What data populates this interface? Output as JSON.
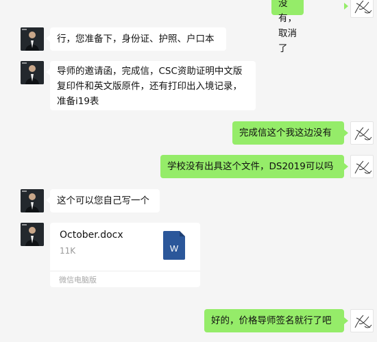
{
  "messages": [
    {
      "side": "right",
      "text": "没有，取消了"
    },
    {
      "side": "left",
      "text": "行，您准备下，身份证、护照、户口本"
    },
    {
      "side": "left",
      "lines": [
        "导师的邀请函，完成信，CSC资助证明中文版",
        "复印件和英文版原件，还有打印出入境记录，",
        "准备i19表"
      ]
    },
    {
      "side": "right",
      "text": "完成信这个我这边没有"
    },
    {
      "side": "right",
      "text": "学校没有出具这个文件，DS2019可以吗"
    },
    {
      "side": "left",
      "text": "这个可以您自己写一个"
    },
    {
      "side": "right",
      "text": "好的，价格导师签名就行了吧"
    }
  ],
  "file": {
    "name": "October.docx",
    "size": "11K",
    "icon_letter": "W",
    "icon": "word-document-icon",
    "source": "微信电脑版"
  },
  "colors": {
    "background": "#f5f5f5",
    "bubble_self": "#95ec69",
    "bubble_other": "#ffffff",
    "word_icon": "#2b579a"
  }
}
